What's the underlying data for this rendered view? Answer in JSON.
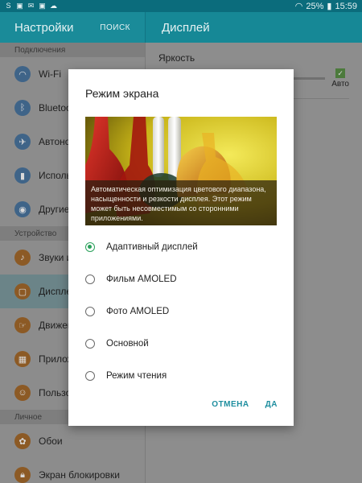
{
  "status_bar": {
    "left_icons": [
      "samsung-icon",
      "image-icon",
      "mail-icon",
      "image-icon",
      "cloud-icon"
    ],
    "battery": "25%",
    "time": "15:59"
  },
  "header": {
    "left_title": "Настройки",
    "search_label": "ПОИСК",
    "right_title": "Дисплей"
  },
  "sidebar": {
    "sections": [
      {
        "header": "Подключения",
        "items": [
          {
            "label": "Wi-Fi",
            "icon": "wifi-icon",
            "color": "blue"
          },
          {
            "label": "Bluetooth",
            "icon": "bluetooth-icon",
            "color": "blue"
          },
          {
            "label": "Автономный режим",
            "icon": "airplane-icon",
            "color": "blue"
          },
          {
            "label": "Использование данных",
            "icon": "data-usage-icon",
            "color": "blue"
          },
          {
            "label": "Другие сети",
            "icon": "more-networks-icon",
            "color": "blue"
          }
        ]
      },
      {
        "header": "Устройство",
        "items": [
          {
            "label": "Звуки и уведомления",
            "icon": "sound-icon",
            "color": "orange"
          },
          {
            "label": "Дисплей",
            "icon": "display-icon",
            "color": "orange",
            "active": true
          },
          {
            "label": "Движения",
            "icon": "motion-icon",
            "color": "orange"
          },
          {
            "label": "Приложения",
            "icon": "apps-icon",
            "color": "orange"
          },
          {
            "label": "Пользователи",
            "icon": "users-icon",
            "color": "orange"
          }
        ]
      },
      {
        "header": "Личное",
        "items": [
          {
            "label": "Обои",
            "icon": "wallpaper-icon",
            "color": "orange"
          },
          {
            "label": "Экран блокировки",
            "icon": "lock-screen-icon",
            "color": "orange"
          }
        ]
      }
    ]
  },
  "display_panel": {
    "brightness_label": "Яркость",
    "auto_label": "Авто"
  },
  "dialog": {
    "title": "Режим экрана",
    "caption": "Автоматическая оптимизация цветового диапазона, насыщенности и резкости дисплея. Этот режим может быть несовместимым со сторонними приложениями.",
    "options": [
      {
        "label": "Адаптивный дисплей",
        "selected": true
      },
      {
        "label": "Фильм AMOLED",
        "selected": false
      },
      {
        "label": "Фото AMOLED",
        "selected": false
      },
      {
        "label": "Основной",
        "selected": false
      },
      {
        "label": "Режим чтения",
        "selected": false
      }
    ],
    "cancel_label": "ОТМЕНА",
    "ok_label": "ДА"
  },
  "colors": {
    "accent": "#1e8e9f",
    "radio_selected": "#2aa15b",
    "status_bar": "#0b6c7c"
  }
}
